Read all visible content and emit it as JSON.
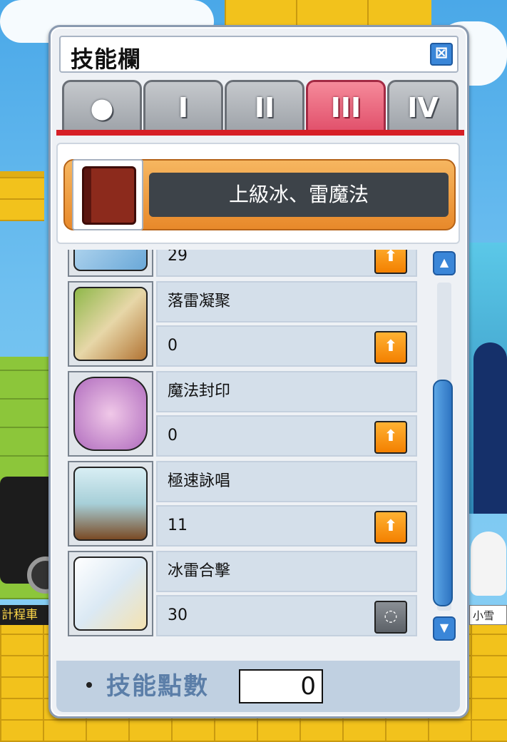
{
  "window": {
    "title": "技能欄",
    "close_icon": "close-icon",
    "tabs": [
      {
        "label": "●",
        "active": false
      },
      {
        "label": "I",
        "active": false
      },
      {
        "label": "II",
        "active": false
      },
      {
        "label": "III",
        "active": true
      },
      {
        "label": "IV",
        "active": false
      }
    ],
    "header": {
      "label": "上級冰、雷魔法",
      "icon": "spellbook-icon"
    },
    "skills": [
      {
        "name": "",
        "level": "29",
        "icon": "ice-skill-icon",
        "upgrade": true
      },
      {
        "name": "落雷凝聚",
        "level": "0",
        "icon": "thunder-concentration-icon",
        "upgrade": true
      },
      {
        "name": "魔法封印",
        "level": "0",
        "icon": "magic-seal-icon",
        "upgrade": true
      },
      {
        "name": "極速詠唱",
        "level": "11",
        "icon": "speed-chant-icon",
        "upgrade": true
      },
      {
        "name": "冰雷合擊",
        "level": "30",
        "icon": "ice-thunder-combo-icon",
        "upgrade": false
      }
    ],
    "footer": {
      "label": "技能點數",
      "points": "0"
    }
  },
  "scene": {
    "sign_left": "計程車",
    "sign_right": "小雪"
  },
  "colors": {
    "accent_active_tab": "#e1506b",
    "tab_underline": "#d61f26",
    "upgrade_button": "#f38000",
    "scroll_blue": "#3a86d8"
  }
}
